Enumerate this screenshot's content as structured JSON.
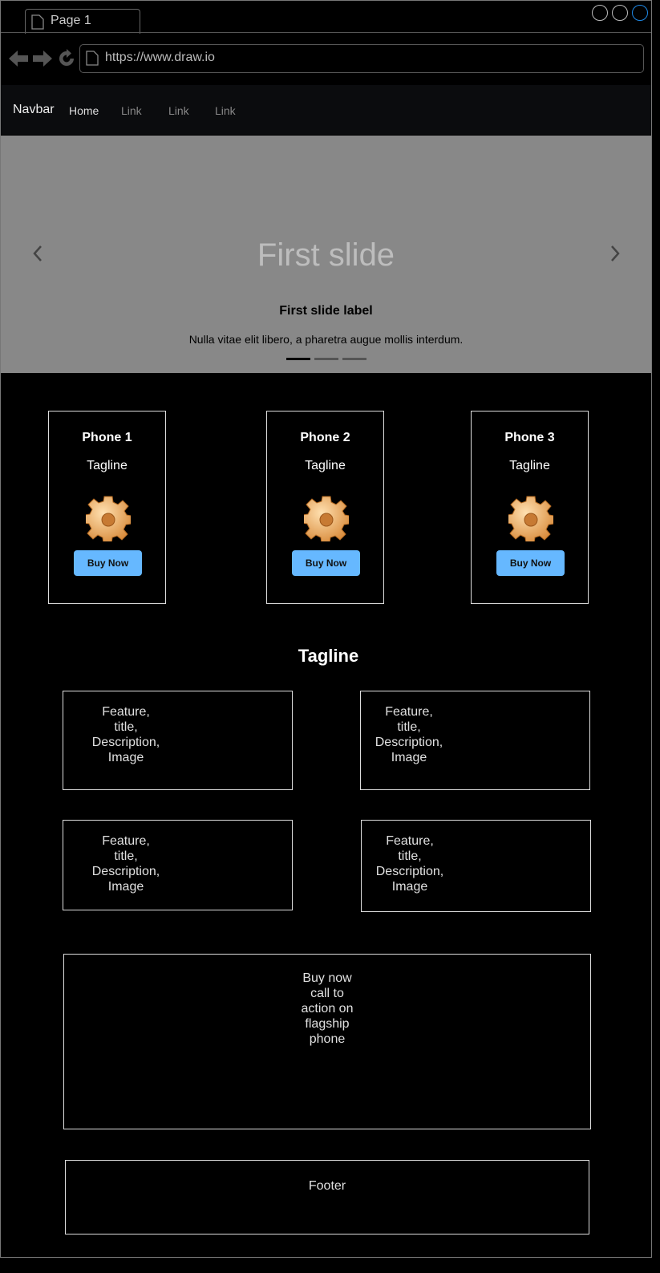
{
  "browser": {
    "tab_label": "Page 1",
    "url": "https://www.draw.io",
    "window_buttons": [
      "minimize",
      "maximize",
      "close"
    ]
  },
  "navbar": {
    "brand": "Navbar",
    "links": [
      "Home",
      "Link",
      "Link",
      "Link"
    ]
  },
  "carousel": {
    "slide_title": "First slide",
    "label": "First slide label",
    "description": "Nulla vitae elit libero, a pharetra augue mollis interdum.",
    "indicators": 3,
    "active_indicator": 1
  },
  "phones": [
    {
      "title": "Phone 1",
      "tagline": "Tagline",
      "button": "Buy Now",
      "icon": "gear-icon"
    },
    {
      "title": "Phone 2",
      "tagline": "Tagline",
      "button": "Buy Now",
      "icon": "gear-icon"
    },
    {
      "title": "Phone 3",
      "tagline": "Tagline",
      "button": "Buy Now",
      "icon": "gear-icon"
    }
  ],
  "section_tagline": "Tagline",
  "features": [
    [
      "Feature,",
      "title,",
      "Description,",
      "Image"
    ],
    [
      "Feature,",
      "title,",
      "Description,",
      "Image"
    ],
    [
      "Feature,",
      "title,",
      "Description,",
      "Image"
    ],
    [
      "Feature,",
      "title,",
      "Description,",
      "Image"
    ]
  ],
  "cta": [
    "Buy now",
    "call to",
    "action on",
    "flagship",
    "phone"
  ],
  "footer": "Footer",
  "colors": {
    "background": "#000000",
    "carousel_bg": "#888888",
    "button": "#66b8ff",
    "navbar_bg": "#0b0c0e",
    "close_button_accent": "#1e88e5"
  }
}
